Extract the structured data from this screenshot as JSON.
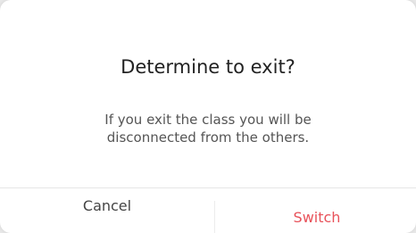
{
  "dialog": {
    "title": "Determine to exit?",
    "message_line1": "If you exit the class you will be",
    "message_line2": "disconnected from the others.",
    "cancel_label": "Cancel",
    "switch_label": "Switch"
  },
  "colors": {
    "switch_accent": "#e8525a",
    "title_text": "#222222",
    "message_text": "#555555"
  }
}
